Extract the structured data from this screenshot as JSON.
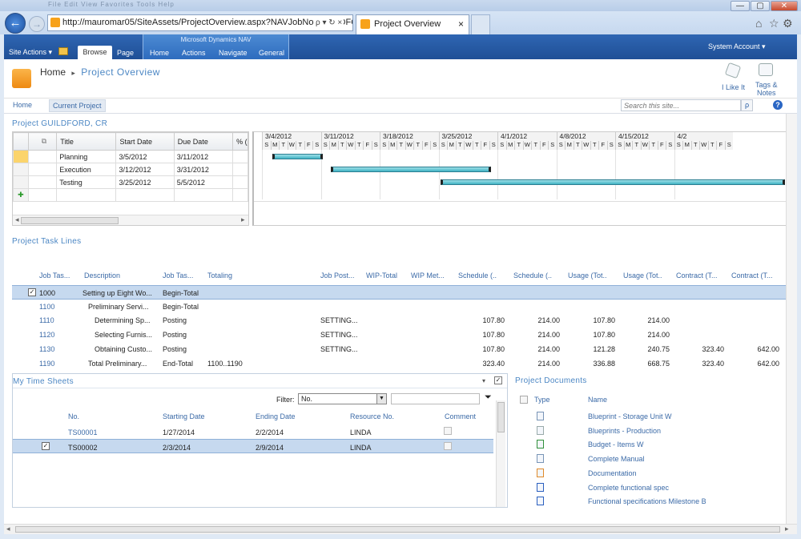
{
  "browser": {
    "menu_ghost": "File   Edit   View   Favorites   Tools   Help",
    "url": "http://mauromar05/SiteAssets/ProjectOverview.aspx?NAVJobNo=GUILDFORD,+:",
    "tab_title": "Project Overview",
    "tab_close": "×",
    "back_glyph": "←",
    "forward_glyph": "→",
    "url_actions": "ρ ▾ ↻ ×",
    "window_buttons": [
      "—",
      "▢",
      "✕"
    ]
  },
  "ribbon": {
    "site_actions": "Site Actions",
    "tabs": [
      "Browse",
      "Page"
    ],
    "nav_group_label": "Microsoft Dynamics NAV",
    "nav_tabs": [
      "Home",
      "Actions",
      "Navigate",
      "General"
    ],
    "user": "System Account"
  },
  "header": {
    "home": "Home",
    "sep": "▸",
    "current": "Project Overview",
    "i_like_it": "I Like It",
    "tags_notes_1": "Tags &",
    "tags_notes_2": "Notes"
  },
  "subnav": {
    "items": [
      "Home",
      "Current Project"
    ],
    "search_placeholder": "Search this site...",
    "help": "?"
  },
  "project": {
    "title": "Project GUILDFORD, CR",
    "columns": [
      "Title",
      "Start Date",
      "Due Date",
      "% ("
    ],
    "rows": [
      {
        "title": "Planning",
        "start": "3/5/2012",
        "due": "3/11/2012"
      },
      {
        "title": "Execution",
        "start": "3/12/2012",
        "due": "3/31/2012"
      },
      {
        "title": "Testing",
        "start": "3/25/2012",
        "due": "5/5/2012"
      }
    ],
    "add_glyph": "✚",
    "scroll_left": "◂",
    "scroll_right": "▸"
  },
  "gantt": {
    "weeks": [
      "3/4/2012",
      "3/11/2012",
      "3/18/2012",
      "3/25/2012",
      "4/1/2012",
      "4/8/2012",
      "4/15/2012",
      "4/2"
    ],
    "day_letters": [
      "S",
      "M",
      "T",
      "W",
      "T",
      "F",
      "S"
    ]
  },
  "tasklines": {
    "title": "Project Task Lines",
    "headers": [
      "Job Tas...",
      "Description",
      "Job Tas...",
      "Totaling",
      "Job Post...",
      "WIP-Total",
      "WIP Met...",
      "Schedule (..",
      "Schedule (..",
      "Usage (Tot..",
      "Usage (Tot..",
      "Contract (T...",
      "Contract (T..."
    ],
    "rows": [
      {
        "no": "1000",
        "desc": "Setting up Eight Wo...",
        "type": "Begin-Total",
        "totaling": "",
        "post": "",
        "s1": "",
        "s2": "",
        "u1": "",
        "u2": "",
        "c1": "",
        "c2": ""
      },
      {
        "no": "1100",
        "desc": "Preliminary Servi...",
        "type": "Begin-Total",
        "totaling": "",
        "post": "",
        "s1": "",
        "s2": "",
        "u1": "",
        "u2": "",
        "c1": "",
        "c2": ""
      },
      {
        "no": "1110",
        "desc": "Determining Sp...",
        "type": "Posting",
        "totaling": "",
        "post": "SETTING...",
        "s1": "107.80",
        "s2": "214.00",
        "u1": "107.80",
        "u2": "214.00",
        "c1": "",
        "c2": ""
      },
      {
        "no": "1120",
        "desc": "Selecting Furnis...",
        "type": "Posting",
        "totaling": "",
        "post": "SETTING...",
        "s1": "107.80",
        "s2": "214.00",
        "u1": "107.80",
        "u2": "214.00",
        "c1": "",
        "c2": ""
      },
      {
        "no": "1130",
        "desc": "Obtaining Custo...",
        "type": "Posting",
        "totaling": "",
        "post": "SETTING...",
        "s1": "107.80",
        "s2": "214.00",
        "u1": "121.28",
        "u2": "240.75",
        "c1": "323.40",
        "c2": "642.00"
      },
      {
        "no": "1190",
        "desc": "Total Preliminary...",
        "type": "End-Total",
        "totaling": "1100..1190",
        "post": "",
        "s1": "323.40",
        "s2": "214.00",
        "u1": "336.88",
        "u2": "668.75",
        "c1": "323.40",
        "c2": "642.00"
      }
    ]
  },
  "timesheets": {
    "title": "My Time Sheets",
    "filter_label": "Filter:",
    "filter_value": "No.",
    "headers": [
      "No.",
      "Starting Date",
      "Ending Date",
      "Resource No.",
      "Comment"
    ],
    "rows": [
      {
        "no": "TS00001",
        "start": "1/27/2014",
        "end": "2/2/2014",
        "res": "LINDA"
      },
      {
        "no": "TS00002",
        "start": "2/3/2014",
        "end": "2/9/2014",
        "res": "LINDA"
      }
    ]
  },
  "documents": {
    "title": "Project Documents",
    "headers": [
      "Type",
      "Name"
    ],
    "items": [
      {
        "name": "Blueprint - Storage Unit W",
        "type": "txt-icon"
      },
      {
        "name": "Blueprints - Production",
        "type": "page-icon"
      },
      {
        "name": "Budget - Items W",
        "type": "excel-icon"
      },
      {
        "name": "Complete Manual",
        "type": "txt-icon"
      },
      {
        "name": "Documentation",
        "type": "image-icon"
      },
      {
        "name": "Complete functional spec",
        "type": "word-icon"
      },
      {
        "name": "Functional specifications Milestone B",
        "type": "word-icon"
      }
    ]
  },
  "colors": {
    "ribbon": "#2557a0",
    "link": "#3b6aa7",
    "selected_row": "#c6d9ef",
    "gantt_bar": "#5cc0cd"
  }
}
